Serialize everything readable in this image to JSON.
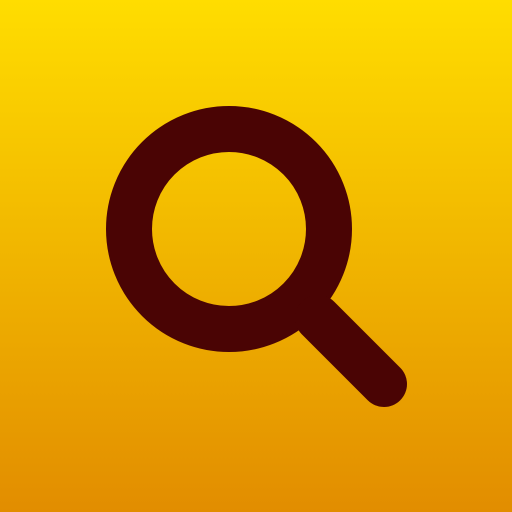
{
  "icon": {
    "name": "search-icon",
    "background_top": "#FFDD00",
    "background_bottom": "#E28D00",
    "glyph_color": "#4A0404"
  }
}
